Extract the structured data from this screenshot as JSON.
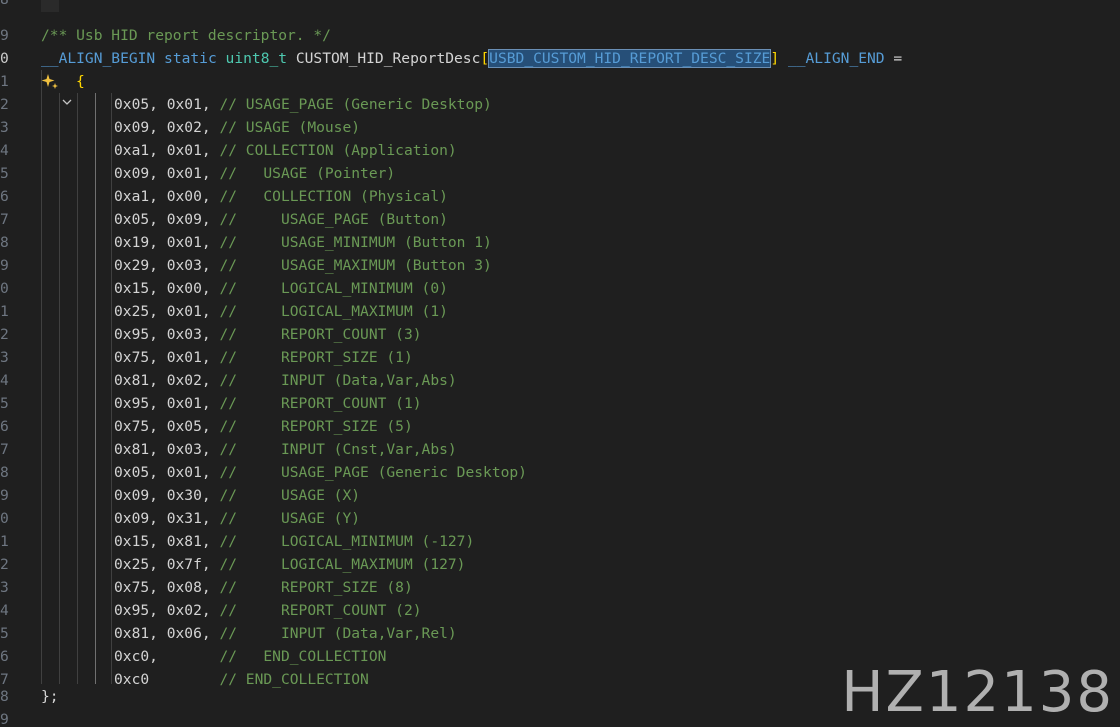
{
  "editor": {
    "line_numbers": [
      "8",
      "9",
      "0",
      "1",
      "2",
      "3",
      "4",
      "5",
      "6",
      "7",
      "8",
      "9",
      "0",
      "1",
      "2",
      "3",
      "4",
      "5",
      "6",
      "7",
      "8",
      "9",
      "0",
      "1",
      "2",
      "3",
      "4",
      "5",
      "6",
      "7",
      "8",
      "9"
    ],
    "comment_header": "/** Usb HID report descriptor. */",
    "decl": {
      "align_begin": "__ALIGN_BEGIN",
      "static": "static",
      "type": "uint8_t",
      "name": "CUSTOM_HID_ReportDesc",
      "bracket_open": "[",
      "size_macro": "USBD_CUSTOM_HID_REPORT_DESC_SIZE",
      "bracket_close": "]",
      "align_end": "__ALIGN_END",
      "equals": "="
    },
    "brace_open": "{",
    "brace_close": "};",
    "rows": [
      {
        "bytes": "0x05, 0x01,",
        "comment": "// USAGE_PAGE (Generic Desktop)"
      },
      {
        "bytes": "0x09, 0x02,",
        "comment": "// USAGE (Mouse)"
      },
      {
        "bytes": "0xa1, 0x01,",
        "comment": "// COLLECTION (Application)"
      },
      {
        "bytes": "0x09, 0x01,",
        "comment": "//   USAGE (Pointer)"
      },
      {
        "bytes": "0xa1, 0x00,",
        "comment": "//   COLLECTION (Physical)"
      },
      {
        "bytes": "0x05, 0x09,",
        "comment": "//     USAGE_PAGE (Button)"
      },
      {
        "bytes": "0x19, 0x01,",
        "comment": "//     USAGE_MINIMUM (Button 1)"
      },
      {
        "bytes": "0x29, 0x03,",
        "comment": "//     USAGE_MAXIMUM (Button 3)"
      },
      {
        "bytes": "0x15, 0x00,",
        "comment": "//     LOGICAL_MINIMUM (0)"
      },
      {
        "bytes": "0x25, 0x01,",
        "comment": "//     LOGICAL_MAXIMUM (1)"
      },
      {
        "bytes": "0x95, 0x03,",
        "comment": "//     REPORT_COUNT (3)"
      },
      {
        "bytes": "0x75, 0x01,",
        "comment": "//     REPORT_SIZE (1)"
      },
      {
        "bytes": "0x81, 0x02,",
        "comment": "//     INPUT (Data,Var,Abs)"
      },
      {
        "bytes": "0x95, 0x01,",
        "comment": "//     REPORT_COUNT (1)"
      },
      {
        "bytes": "0x75, 0x05,",
        "comment": "//     REPORT_SIZE (5)"
      },
      {
        "bytes": "0x81, 0x03,",
        "comment": "//     INPUT (Cnst,Var,Abs)"
      },
      {
        "bytes": "0x05, 0x01,",
        "comment": "//     USAGE_PAGE (Generic Desktop)"
      },
      {
        "bytes": "0x09, 0x30,",
        "comment": "//     USAGE (X)"
      },
      {
        "bytes": "0x09, 0x31,",
        "comment": "//     USAGE (Y)"
      },
      {
        "bytes": "0x15, 0x81,",
        "comment": "//     LOGICAL_MINIMUM (-127)"
      },
      {
        "bytes": "0x25, 0x7f,",
        "comment": "//     LOGICAL_MAXIMUM (127)"
      },
      {
        "bytes": "0x75, 0x08,",
        "comment": "//     REPORT_SIZE (8)"
      },
      {
        "bytes": "0x95, 0x02,",
        "comment": "//     REPORT_COUNT (2)"
      },
      {
        "bytes": "0x81, 0x06,",
        "comment": "//     INPUT (Data,Var,Rel)"
      },
      {
        "bytes": "0xc0,      ",
        "comment": "//   END_COLLECTION"
      },
      {
        "bytes": "0xc0       ",
        "comment": "// END_COLLECTION"
      }
    ]
  },
  "watermark": "HZ12138",
  "colors": {
    "background": "#1f1f1f",
    "comment": "#6a9955",
    "keyword": "#569cd6",
    "type": "#4ec9b0",
    "function": "#dcdcaa",
    "bracket": "#ffd700",
    "selection": "#264f78"
  },
  "icons": {
    "fold": "chevron-down-icon",
    "suggestion": "sparkle-icon"
  }
}
